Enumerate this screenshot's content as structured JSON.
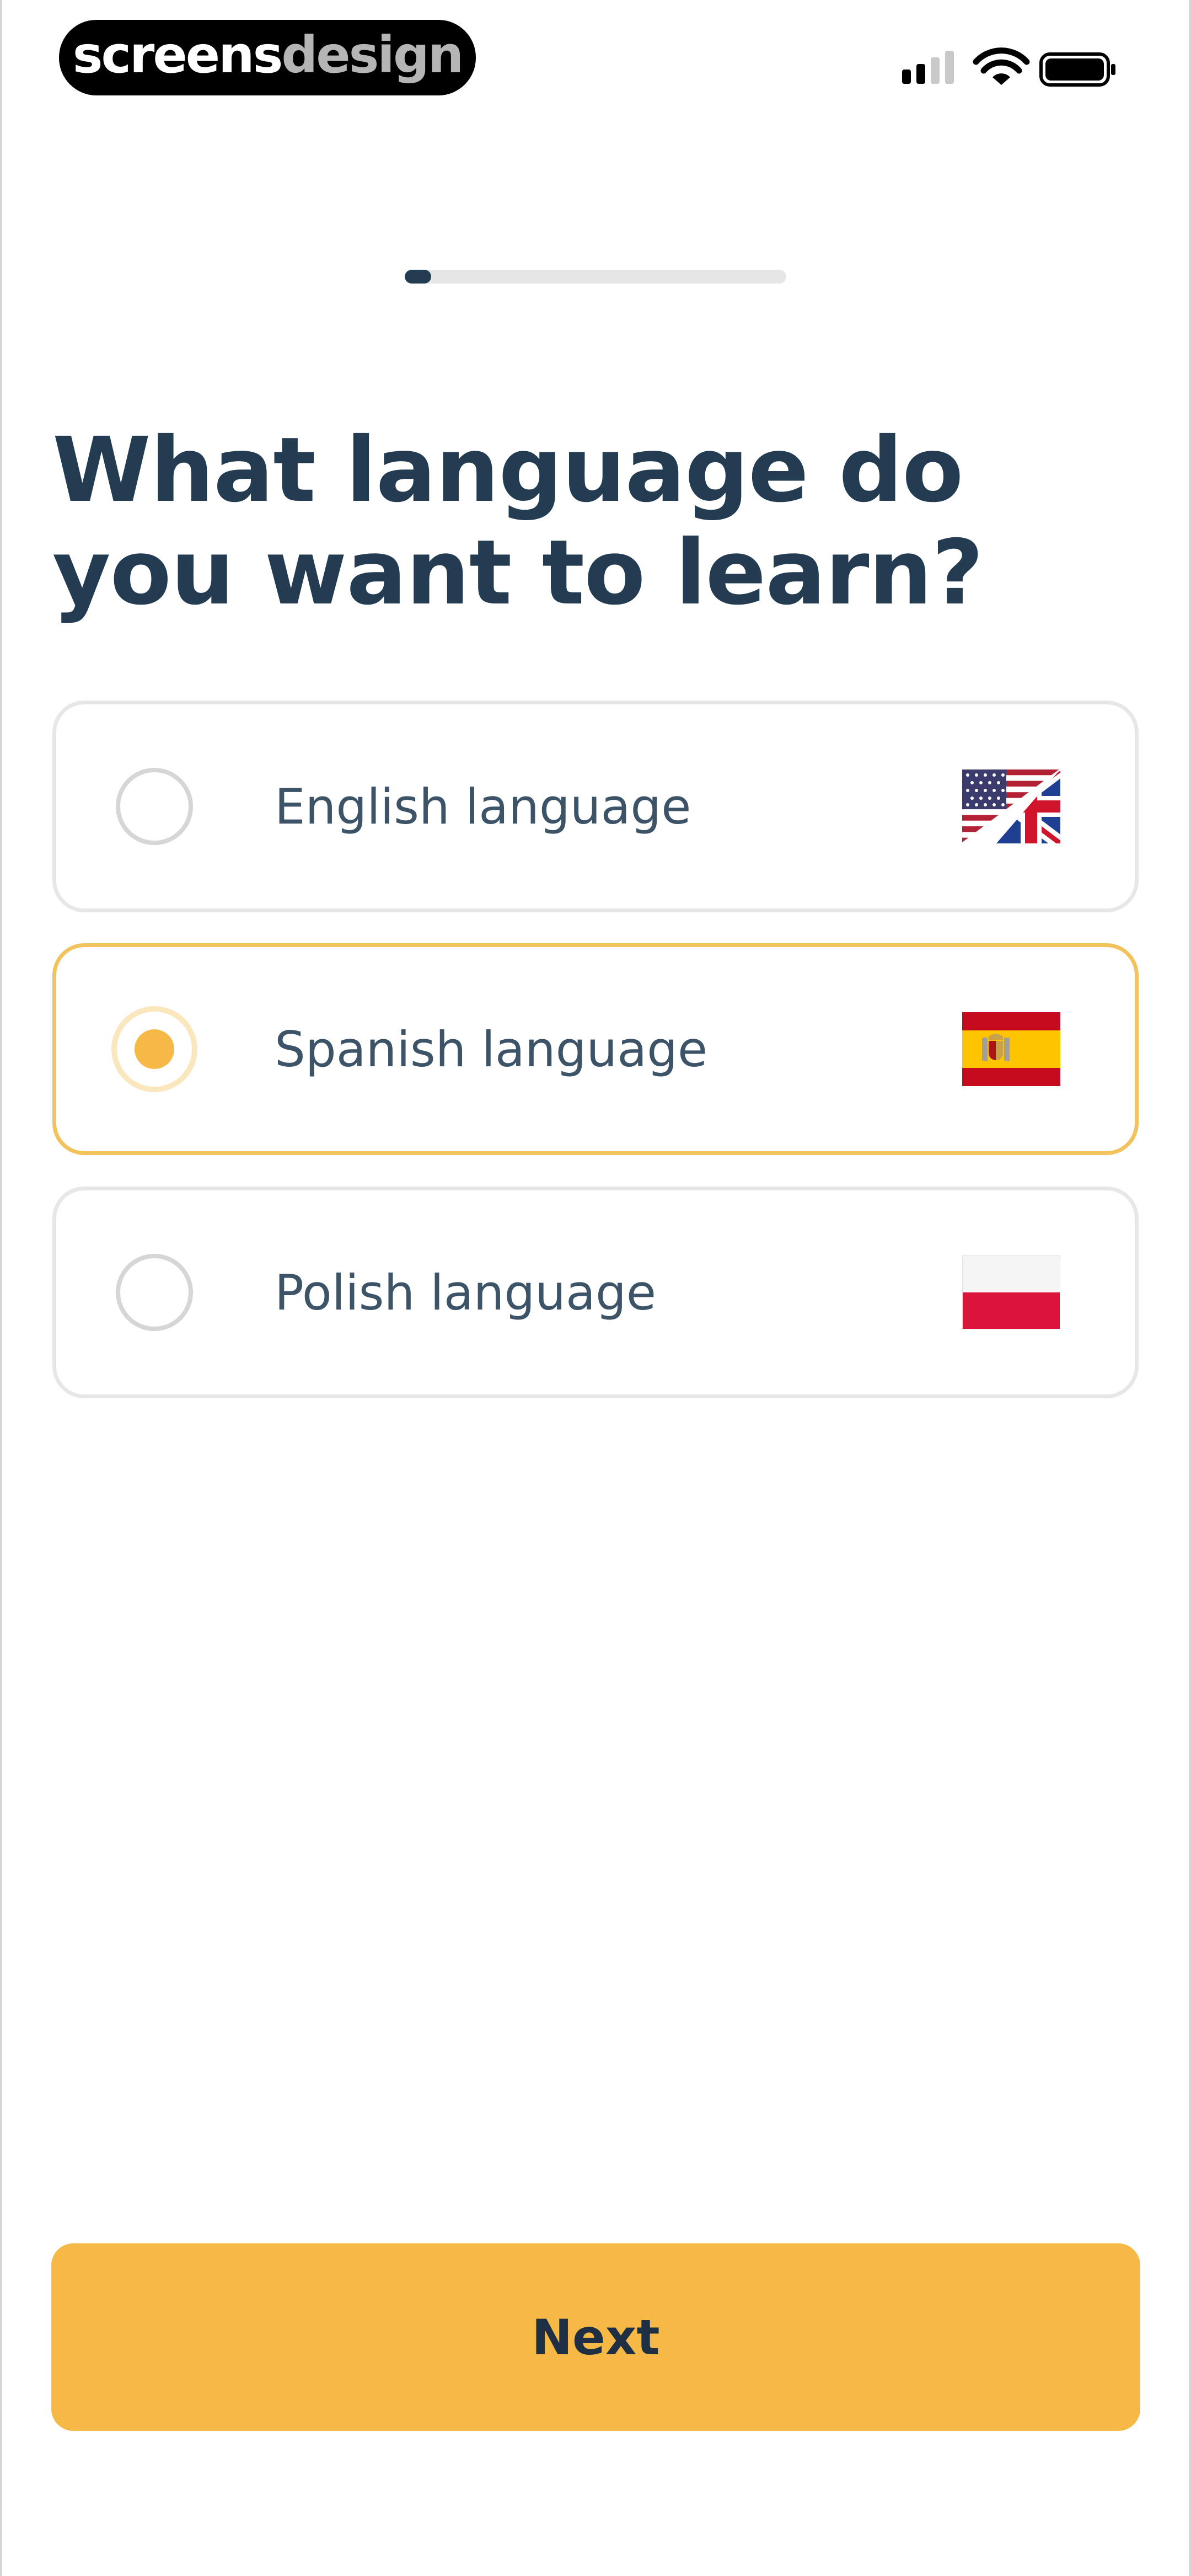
{
  "status_bar": {
    "brand_primary": "screens",
    "brand_secondary": "design",
    "icons": [
      "cellular-signal-icon",
      "wifi-icon",
      "battery-icon"
    ]
  },
  "progress": {
    "fraction": 0.07
  },
  "question": {
    "title": "What language do you want to learn?"
  },
  "options": [
    {
      "label": "English language",
      "flag_icon": "us-uk-flag-icon",
      "selected": false
    },
    {
      "label": "Spanish language",
      "flag_icon": "spain-flag-icon",
      "selected": true
    },
    {
      "label": "Polish language",
      "flag_icon": "poland-flag-icon",
      "selected": false
    }
  ],
  "next_button": {
    "label": "Next"
  },
  "colors": {
    "title": "#243c52",
    "accent": "#f7b946",
    "selected_border": "#f2c25c",
    "option_text": "#3d5468",
    "progress_fill": "#243c52",
    "progress_track": "#e6e6e6"
  }
}
